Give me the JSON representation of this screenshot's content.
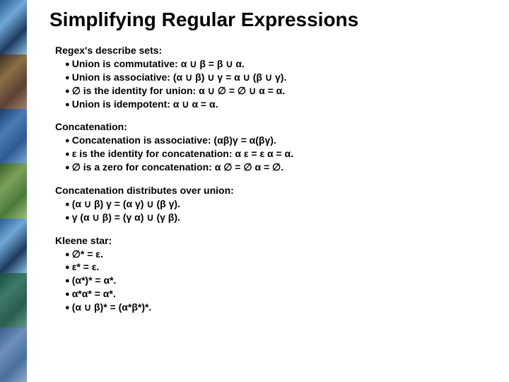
{
  "title": "Simplifying Regular Expressions",
  "sections": [
    {
      "head": "Regex's describe sets:",
      "bullets": [
        "Union is commutative:  α ∪ β = β ∪ α.",
        "Union is associative: (α ∪ β) ∪ γ = α ∪ (β ∪ γ).",
        "∅ is the identity for union:  α ∪ ∅ = ∅ ∪ α = α.",
        "Union is idempotent:  α ∪ α = α."
      ]
    },
    {
      "head": "Concatenation:",
      "bullets": [
        "Concatenation is associative:  (αβ)γ = α(βγ).",
        "ε is the identity for concatenation:  α ε = ε α = α.",
        "∅ is a zero for concatenation:  α ∅ = ∅ α = ∅."
      ]
    },
    {
      "head": "Concatenation distributes over union:",
      "bullets": [
        "(α ∪ β) γ = (α γ) ∪ (β γ).",
        "γ (α ∪ β) = (γ α) ∪ (γ β)."
      ]
    },
    {
      "head": "Kleene star:",
      "bullets": [
        "∅* = ε.",
        "ε* = ε.",
        "(α*)* = α*.",
        "α*α* = α*.",
        "(α ∪ β)* = (α*β*)*."
      ]
    }
  ]
}
